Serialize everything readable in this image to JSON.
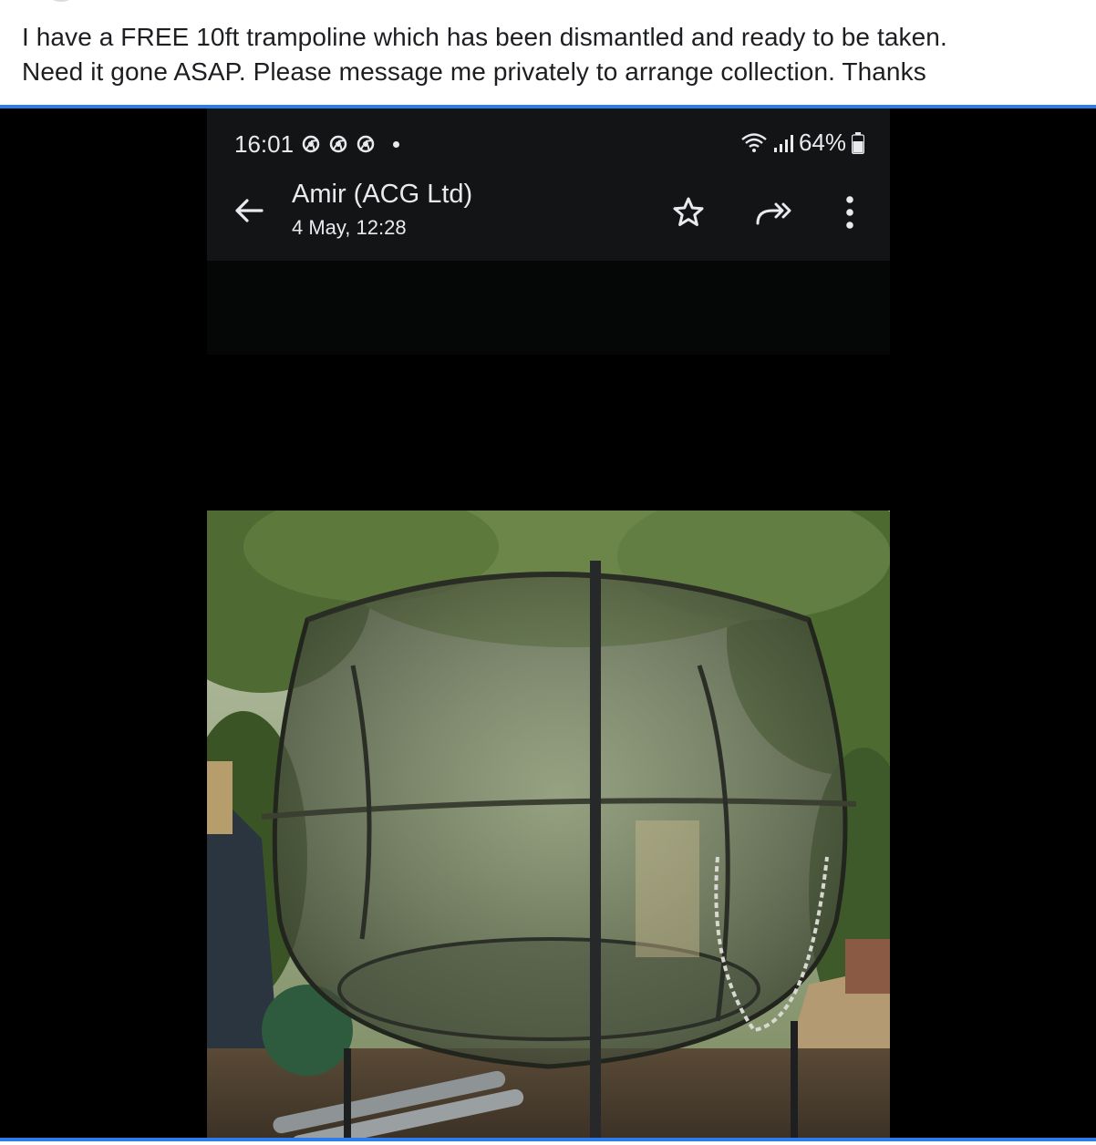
{
  "post": {
    "line1": "I have a FREE 10ft trampoline which has been dismantled and ready to be taken.",
    "line2": "Need it gone ASAP. Please message me privately to arrange collection. Thanks"
  },
  "phone": {
    "status": {
      "time": "16:01",
      "battery": "64%",
      "icons": [
        "chrome-icon",
        "chrome-icon",
        "chrome-icon",
        "notification-dot",
        "wifi-icon",
        "signal-icon",
        "battery-icon"
      ]
    },
    "email": {
      "sender": "Amir (ACG Ltd)",
      "date": "4 May, 12:28",
      "actions": [
        "back-arrow-icon",
        "star-icon",
        "forward-icon",
        "more-vert-icon"
      ]
    }
  },
  "colors": {
    "accent_rule": "#2b7de9",
    "phone_bar": "#121416",
    "text_dark": "#1c1e21"
  }
}
